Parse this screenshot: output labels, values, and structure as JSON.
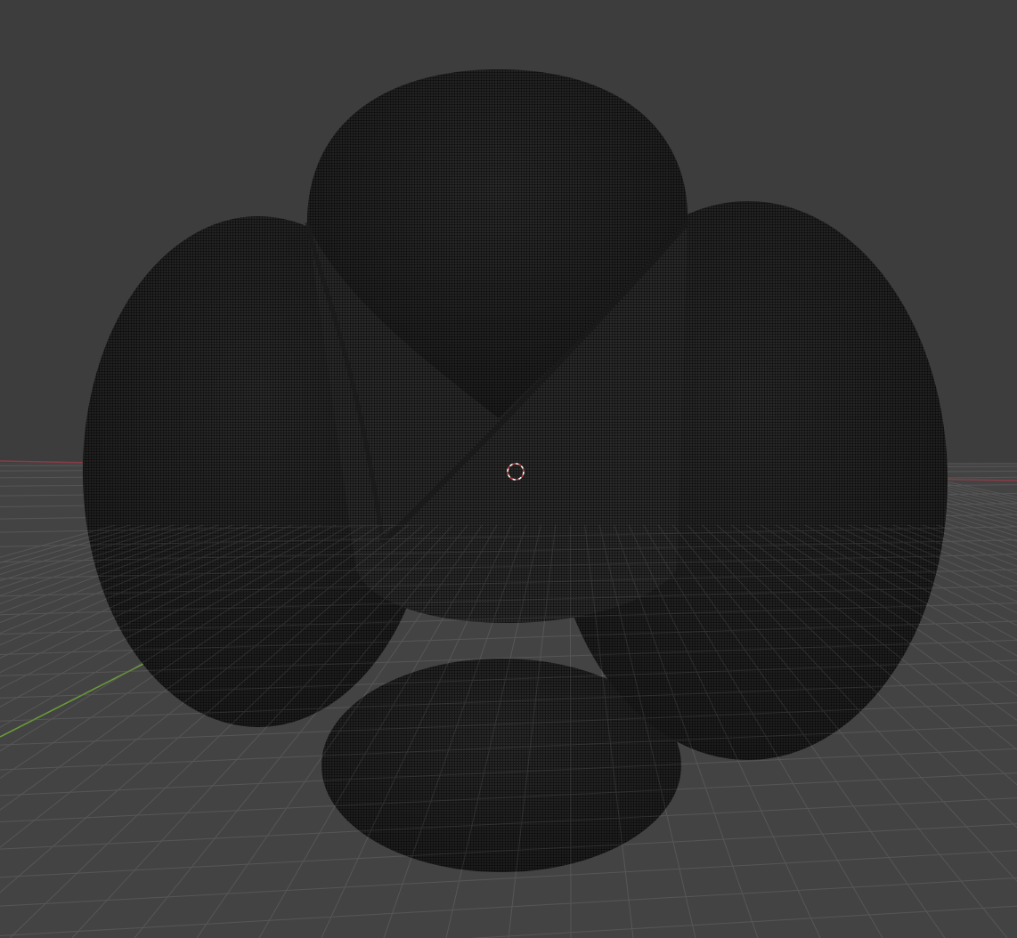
{
  "viewport": {
    "background_color": "#3d3d3d",
    "grid_floor_color": "#434343",
    "grid_line_color": "#565656",
    "x_axis_color": "#8a3c46",
    "y_axis_color": "#6a9a38"
  },
  "object": {
    "shape": "four-lobed mesh (spherical harmonic surface)",
    "display_mode": "wireframe",
    "fill_color": "#2a2a2a",
    "wire_color": "#111111",
    "lobe_count": 4
  },
  "cursor_3d": {
    "icon": "3d-cursor-icon",
    "ring_color_light": "#ffffff",
    "ring_color_accent": "#c83c3c"
  }
}
